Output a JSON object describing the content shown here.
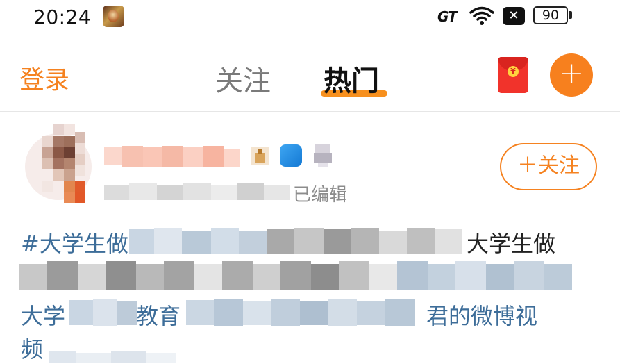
{
  "status_bar": {
    "time": "20:24",
    "carrier_label": "GT",
    "battery": "90",
    "icons": [
      "game-app-icon",
      "wifi-icon",
      "no-sim-icon",
      "battery-icon"
    ]
  },
  "nav": {
    "login": "登录",
    "tabs": [
      {
        "label": "关注",
        "active": false
      },
      {
        "label": "热门",
        "active": true
      }
    ],
    "accent_color": "#f7901e",
    "right_icons": [
      "red-packet-icon",
      "add-icon"
    ]
  },
  "post": {
    "author_meta_suffix": "已编辑",
    "follow_button": "＋关注",
    "text_lines": {
      "line1_a": "#大学生做",
      "line1_b": "大学生做",
      "line3_a": "大学",
      "line3_b": "教育",
      "line3_c": "君的微博视",
      "line4": "频"
    },
    "link_color": "#3d6d99"
  }
}
